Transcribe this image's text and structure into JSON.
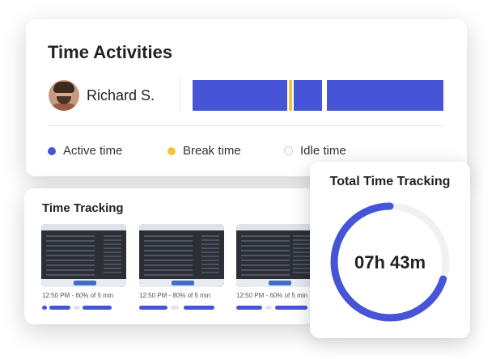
{
  "activities": {
    "title": "Time Activities",
    "user": {
      "name": "Richard S."
    },
    "legend": [
      {
        "label": "Active time",
        "color": "#4555d6"
      },
      {
        "label": "Break time",
        "color": "#f5c23d"
      },
      {
        "label": "Idle time",
        "color": "#ffffff"
      }
    ],
    "colors": {
      "active": "#4555d6",
      "break": "#f5c23d",
      "idle": "#ffffff"
    }
  },
  "tracking": {
    "title": "Time Tracking",
    "screenshots": [
      {
        "caption": "12:50 PM - 60% of 5 min"
      },
      {
        "caption": "12:50 PM - 80% of 5 min"
      },
      {
        "caption": "12:50 PM - 60% of 5 min"
      }
    ]
  },
  "total": {
    "title": "Total Time Tracking",
    "value": "07h 43m",
    "progress_percent": 70,
    "ring_color": "#4555d6",
    "track_color": "#f1f1f1"
  }
}
